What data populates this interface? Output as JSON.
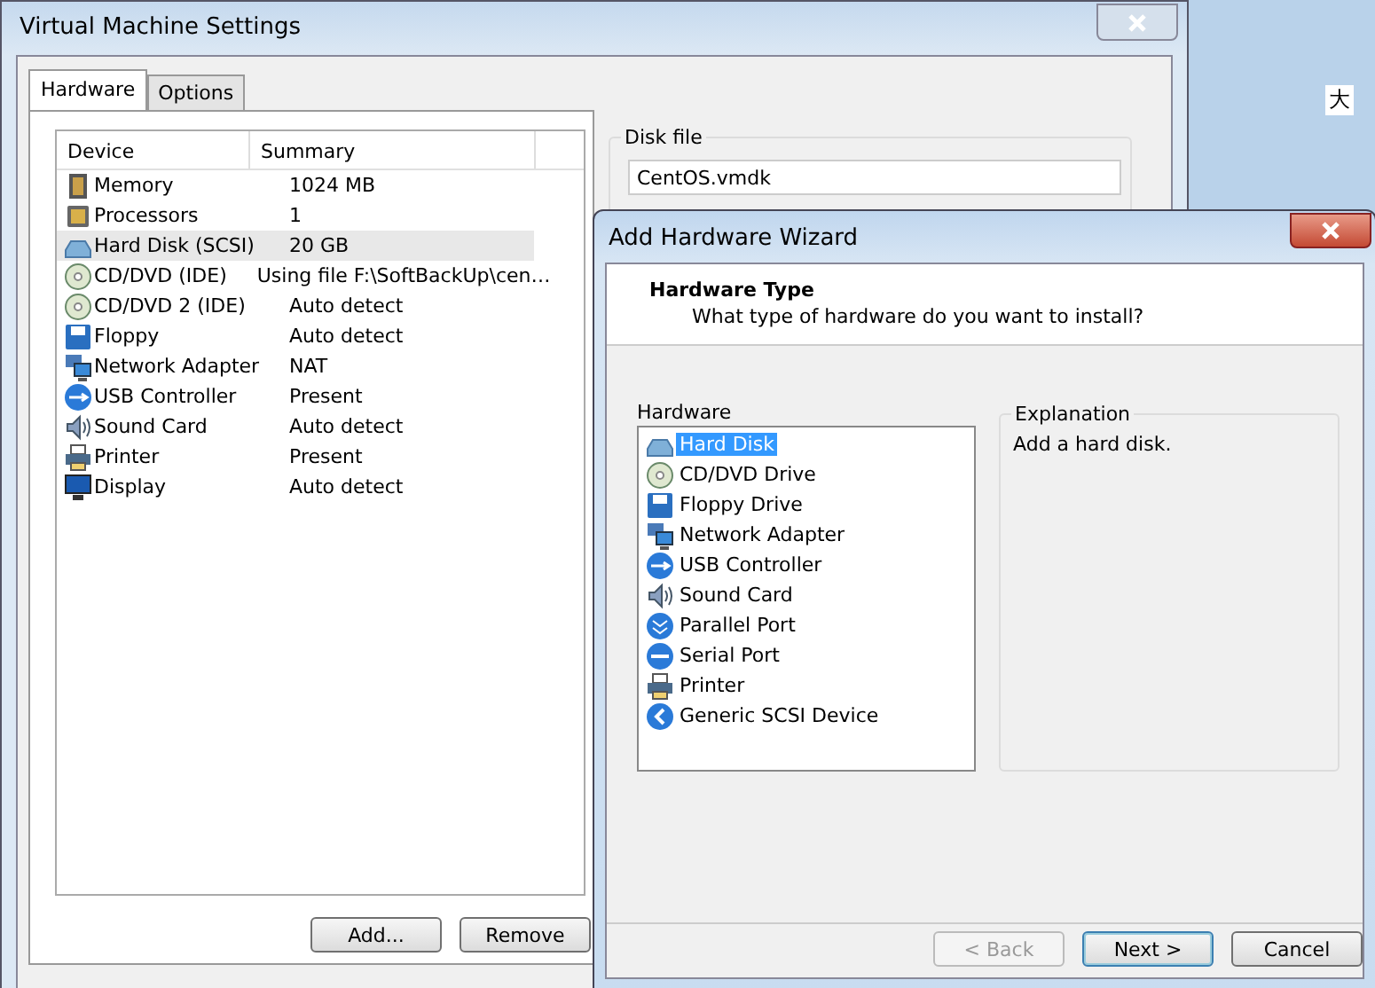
{
  "desktop": {
    "side_label": "大"
  },
  "settings_window": {
    "title": "Virtual Machine Settings",
    "tabs": [
      {
        "label": "Hardware",
        "selected": true
      },
      {
        "label": "Options",
        "selected": false
      }
    ],
    "device_list": {
      "columns": [
        "Device",
        "Summary"
      ],
      "rows": [
        {
          "kind": "memory",
          "device": "Memory",
          "summary": "1024 MB",
          "selected": false
        },
        {
          "kind": "processor",
          "device": "Processors",
          "summary": "1",
          "selected": false
        },
        {
          "kind": "disk",
          "device": "Hard Disk (SCSI)",
          "summary": "20 GB",
          "selected": true
        },
        {
          "kind": "cd",
          "device": "CD/DVD (IDE)",
          "summary": "Using file F:\\SoftBackUp\\cen…",
          "selected": false
        },
        {
          "kind": "cd",
          "device": "CD/DVD 2 (IDE)",
          "summary": "Auto detect",
          "selected": false
        },
        {
          "kind": "floppy",
          "device": "Floppy",
          "summary": "Auto detect",
          "selected": false
        },
        {
          "kind": "network",
          "device": "Network Adapter",
          "summary": "NAT",
          "selected": false
        },
        {
          "kind": "usb",
          "device": "USB Controller",
          "summary": "Present",
          "selected": false
        },
        {
          "kind": "sound",
          "device": "Sound Card",
          "summary": "Auto detect",
          "selected": false
        },
        {
          "kind": "printer",
          "device": "Printer",
          "summary": "Present",
          "selected": false
        },
        {
          "kind": "display",
          "device": "Display",
          "summary": "Auto detect",
          "selected": false
        }
      ]
    },
    "buttons": [
      {
        "label": "Add..."
      },
      {
        "label": "Remove"
      }
    ],
    "disk_file": {
      "legend": "Disk file",
      "value": "CentOS.vmdk"
    }
  },
  "wizard": {
    "title": "Add Hardware Wizard",
    "heading": "Hardware Type",
    "subheading": "What type of hardware do you want to install?",
    "hardware_label": "Hardware",
    "hardware_items": [
      {
        "kind": "disk",
        "label": "Hard Disk",
        "selected": true
      },
      {
        "kind": "cd",
        "label": "CD/DVD Drive",
        "selected": false
      },
      {
        "kind": "floppy",
        "label": "Floppy Drive",
        "selected": false
      },
      {
        "kind": "network",
        "label": "Network Adapter",
        "selected": false
      },
      {
        "kind": "usb",
        "label": "USB Controller",
        "selected": false
      },
      {
        "kind": "sound",
        "label": "Sound Card",
        "selected": false
      },
      {
        "kind": "parallel",
        "label": "Parallel Port",
        "selected": false
      },
      {
        "kind": "serial",
        "label": "Serial Port",
        "selected": false
      },
      {
        "kind": "printer",
        "label": "Printer",
        "selected": false
      },
      {
        "kind": "scsi",
        "label": "Generic SCSI Device",
        "selected": false
      }
    ],
    "explanation": {
      "legend": "Explanation",
      "text": "Add a hard disk."
    },
    "buttons": [
      {
        "label": "< Back",
        "disabled": true,
        "default": false
      },
      {
        "label": "Next >",
        "disabled": false,
        "default": true
      },
      {
        "label": "Cancel",
        "disabled": false,
        "default": false
      }
    ]
  }
}
